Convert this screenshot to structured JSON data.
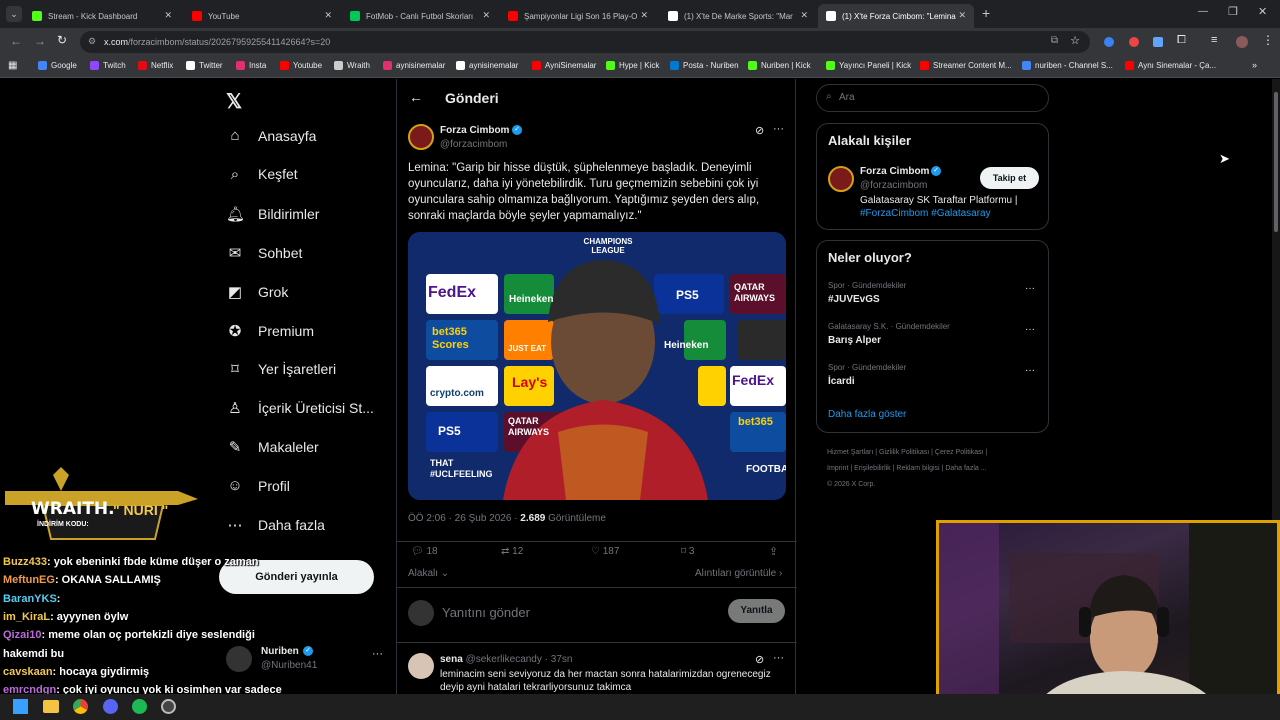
{
  "tabs": [
    {
      "label": "Stream - Kick Dashboard",
      "color": "#53fc18"
    },
    {
      "label": "YouTube",
      "color": "#ff0000"
    },
    {
      "label": "FotMob - Canlı Futbol Skorları",
      "color": "#00c853"
    },
    {
      "label": "Şampiyonlar Ligi Son 16 Play-O",
      "color": "#ff0000"
    },
    {
      "label": "(1) X'te De Marke Sports: \"Mar",
      "color": "#ffffff"
    },
    {
      "label": "(1) X'te Forza Cimbom: \"Lemina",
      "color": "#ffffff"
    }
  ],
  "address": {
    "host": "x.com",
    "path": "/forzacimbom/status/2026795925541142664?s=20"
  },
  "bookmarks": [
    {
      "label": "Google",
      "color": "#4285f4"
    },
    {
      "label": "Twitch",
      "color": "#9146ff"
    },
    {
      "label": "Netflix",
      "color": "#e50914"
    },
    {
      "label": "Twitter",
      "color": "#ffffff"
    },
    {
      "label": "Insta",
      "color": "#e1306c"
    },
    {
      "label": "Youtube",
      "color": "#ff0000"
    },
    {
      "label": "Wraith",
      "color": "#cccccc"
    },
    {
      "label": "aynisinemalar",
      "color": "#e1306c"
    },
    {
      "label": "aynisinemalar",
      "color": "#ffffff"
    },
    {
      "label": "AyniSinemalar",
      "color": "#ff0000"
    },
    {
      "label": "Hype | Kick",
      "color": "#53fc18"
    },
    {
      "label": "Posta - Nuriben",
      "color": "#0078d4"
    },
    {
      "label": "Nuriben | Kick",
      "color": "#53fc18"
    },
    {
      "label": "Yayıncı Paneli | Kick",
      "color": "#53fc18"
    },
    {
      "label": "Streamer Content M...",
      "color": "#ff0000"
    },
    {
      "label": "nuriben - Channel S...",
      "color": "#4285f4"
    },
    {
      "label": "Aynı Sinemalar - Ça...",
      "color": "#ff0000"
    }
  ],
  "nav": {
    "items": [
      "Anasayfa",
      "Keşfet",
      "Bildirimler",
      "Sohbet",
      "Grok",
      "Premium",
      "Yer İşaretleri",
      "İçerik Üreticisi St...",
      "Makaleler",
      "Profil",
      "Daha fazla"
    ],
    "post_button": "Gönderi yayınla",
    "account": {
      "name": "Nuriben",
      "handle": "@Nuriben41"
    }
  },
  "header": {
    "title": "Gönderi"
  },
  "tweet": {
    "author": "Forza Cimbom",
    "handle": "@forzacimbom",
    "text": "Lemina: \"Garip bir hisse düştük, şüphelenmeye başladık. Deneyimli oyuncularız, daha iyi yönetebilirdik. Turu geçmemizin sebebini çok iyi oyunculara sahip olmamıza bağlıyorum. Yaptığımız şeyden ders alıp, sonraki maçlarda böyle şeyler yapmamalıyız.\"",
    "time": "ÖÖ 2:06 · 26 Şub 2026 · ",
    "views": "2.689",
    "views_label": " Görüntüleme",
    "replies": "18",
    "retweets": "12",
    "likes": "187",
    "bookmarks": "3",
    "relevant": "Alakalı",
    "quotes": "Alıntıları görüntüle",
    "reply_placeholder": "Yanıtını gönder",
    "reply_button": "Yanıtla",
    "image_texts": [
      "CHAMPIONS LEAGUE",
      "FedEx",
      "Heineken",
      "PS5",
      "QATAR AIRWAYS",
      "bet365 Scores",
      "JUST EAT",
      "Heineken",
      "FedEx",
      "crypto.com",
      "Lay's",
      "QATAR AIRWAYS",
      "bet365",
      "PS5",
      "THAT #UCLFEELING",
      "FOOTBA"
    ]
  },
  "reply": {
    "author": "sena",
    "handle": "@sekerlikecandy · 37sn",
    "text": "leminacim seni seviyoruz da her mactan sonra hatalarimizdan ogrenecegiz deyip ayni hatalari tekrarliyorsunuz takimca"
  },
  "search": {
    "placeholder": "Ara"
  },
  "related": {
    "title": "Alakalı kişiler",
    "name": "Forza Cimbom",
    "handle": "@forzacimbom",
    "follow": "Takip et",
    "bio": "Galatasaray SK Taraftar Platformu |",
    "tags": "#ForzaCimbom #Galatasaray"
  },
  "trends": {
    "title": "Neler oluyor?",
    "items": [
      {
        "context": "Spor · Gündemdekiler",
        "topic": "#JUVEvGS"
      },
      {
        "context": "Galatasaray S.K. · Gündemdekiler",
        "topic": "Barış Alper"
      },
      {
        "context": "Spor · Gündemdekiler",
        "topic": "İcardi"
      }
    ],
    "more": "Daha fazla göster"
  },
  "footer": {
    "links": [
      "Hizmet Şartları",
      "Gizlilik Politikası",
      "Çerez Politikası",
      "Imprint",
      "Erişilebilirlik",
      "Reklam bilgisi",
      "Daha fazla ..."
    ],
    "copyright": "© 2026 X Corp."
  },
  "overlay": {
    "wraith": "WRAITH.",
    "code_label": "İNDİRİM KODU:",
    "code": "\" NURI \""
  },
  "chat": [
    {
      "user": "Buzz433",
      "color": "#f2c94c",
      "msg": ": yok ebeninki fbde küme düşer o zaman"
    },
    {
      "user": "MeftunEG",
      "color": "#f2994a",
      "msg": ": OKANA SALLAMIŞ"
    },
    {
      "user": "BaranYKS",
      "color": "#56ccf2",
      "msg": ": "
    },
    {
      "user": "im_KiraL",
      "color": "#f2c94c",
      "msg": ": ayyynen öylw"
    },
    {
      "user": "Qizai10",
      "color": "#bb6bd9",
      "msg": ": meme olan oç portekizli diye seslendiği"
    },
    {
      "user": "",
      "color": "#ffffff",
      "msg": "hakemdi bu"
    },
    {
      "user": "cavskaan",
      "color": "#f2c94c",
      "msg": ": hocaya giydirmiş"
    },
    {
      "user": "emrcndgn",
      "color": "#bb6bd9",
      "msg": ": çok iyi oyuncu yok ki osimhen var sadece"
    }
  ]
}
